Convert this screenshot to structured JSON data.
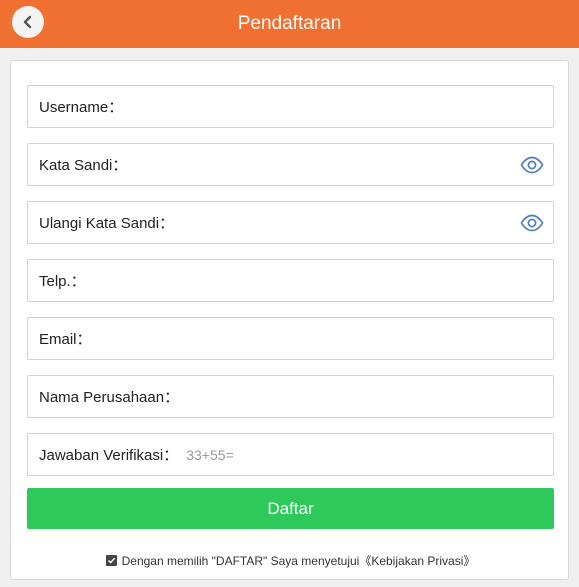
{
  "header": {
    "title": "Pendaftaran",
    "back_icon": "chevron-left-icon",
    "background": "#f07032"
  },
  "form": {
    "fields": [
      {
        "label": "Username：",
        "value": "",
        "placeholder": "",
        "has_eye": false
      },
      {
        "label": "Kata Sandi：",
        "value": "",
        "placeholder": "",
        "has_eye": true
      },
      {
        "label": "Ulangi Kata Sandi：",
        "value": "",
        "placeholder": "",
        "has_eye": true
      },
      {
        "label": "Telp.：",
        "value": "",
        "placeholder": "",
        "has_eye": false
      },
      {
        "label": "Email：",
        "value": "",
        "placeholder": "",
        "has_eye": false
      },
      {
        "label": "Nama Perusahaan：",
        "value": "",
        "placeholder": "",
        "has_eye": false
      },
      {
        "label": "Jawaban Verifikasi：",
        "value": "",
        "placeholder": "33+55=",
        "has_eye": false
      }
    ],
    "eye_icon": "eye-icon",
    "eye_color": "#4f7ec4",
    "submit_label": "Daftar",
    "submit_color": "#2ec95a"
  },
  "agreement": {
    "checked": true,
    "text": "Dengan memilih \"DAFTAR\" Saya menyetujui《Kebijakan Privasi》"
  }
}
